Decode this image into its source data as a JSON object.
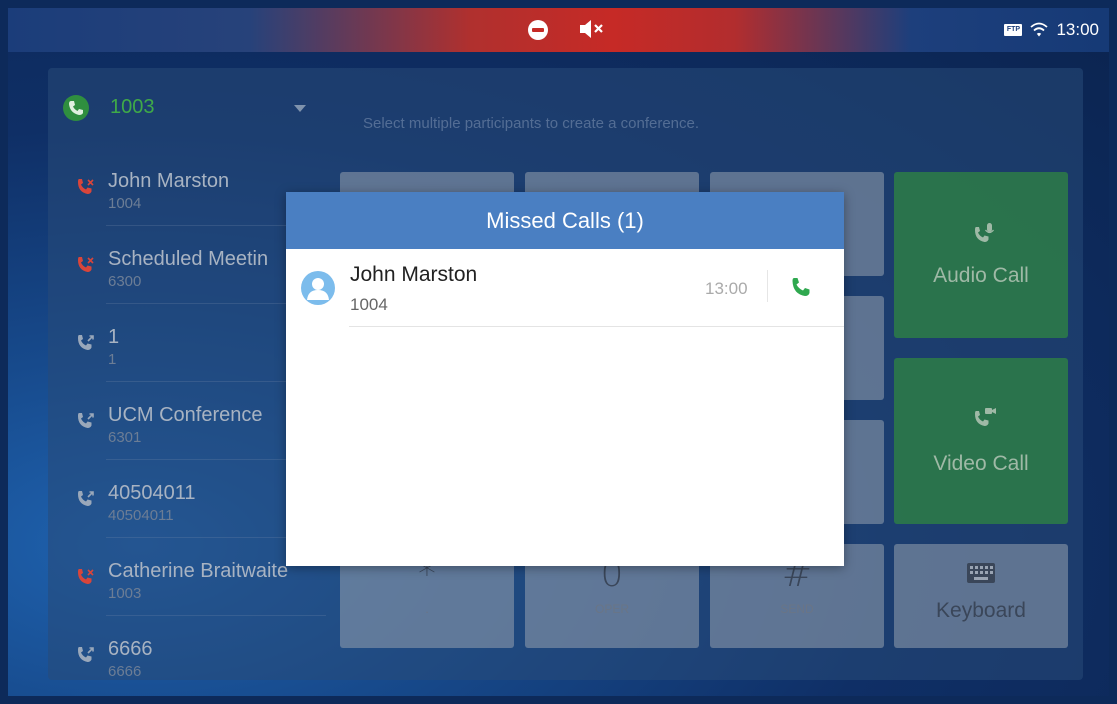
{
  "status_bar": {
    "icons": [
      "do-not-disturb-icon",
      "mute-icon",
      "ftp-icon",
      "wifi-icon"
    ],
    "time": "13:00",
    "ftp_label": "FTP"
  },
  "account": {
    "number": "1003",
    "color": "#3faa48"
  },
  "hint": "Select multiple participants to create a conference.",
  "history": [
    {
      "name": "John Marston",
      "number": "1004",
      "type": "missed"
    },
    {
      "name": "Scheduled Meetin",
      "number": "6300",
      "type": "missed"
    },
    {
      "name": "1",
      "number": "1",
      "type": "outgoing"
    },
    {
      "name": "UCM Conference",
      "number": "6301",
      "type": "outgoing"
    },
    {
      "name": "40504011",
      "number": "40504011",
      "type": "outgoing"
    },
    {
      "name": "Catherine Braitwaite",
      "number": "1003",
      "type": "missed"
    },
    {
      "name": "6666",
      "number": "6666",
      "type": "outgoing"
    }
  ],
  "keypad": {
    "star": {
      "main": "*",
      "sub": "."
    },
    "zero": {
      "main": "0",
      "sub": "OPER"
    },
    "hash": {
      "main": "#",
      "sub": "SEND"
    }
  },
  "actions": {
    "audio_call": "Audio Call",
    "video_call": "Video Call",
    "keyboard": "Keyboard"
  },
  "dialog": {
    "title": "Missed Calls (1)",
    "items": [
      {
        "name": "John Marston",
        "number": "1004",
        "time": "13:00"
      }
    ]
  },
  "colors": {
    "dialog_header": "#4a7fc2",
    "call_green": "#2fa84f",
    "missed_red": "#d9453a"
  }
}
